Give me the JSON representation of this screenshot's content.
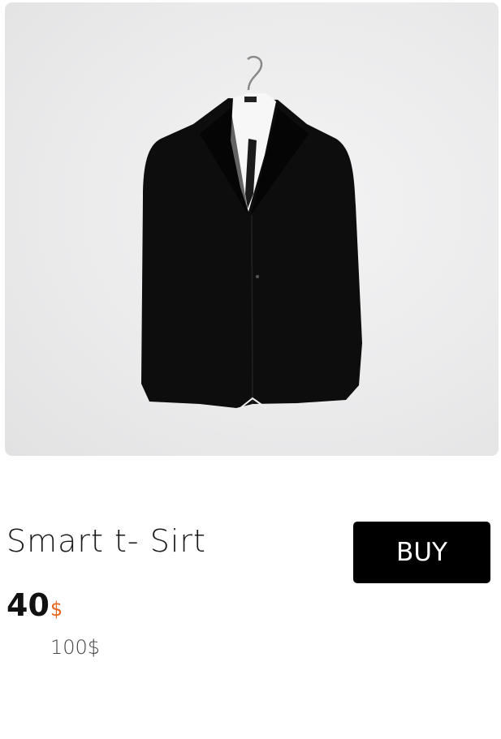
{
  "product": {
    "image_subject": "jacket-on-hanger",
    "title": "Smart t- Sirt",
    "price": "40",
    "currency": "$",
    "old_price": "100$",
    "buy_label": "BUY"
  },
  "colors": {
    "accent": "#e8641e",
    "button_bg": "#000000",
    "button_text": "#ffffff"
  }
}
